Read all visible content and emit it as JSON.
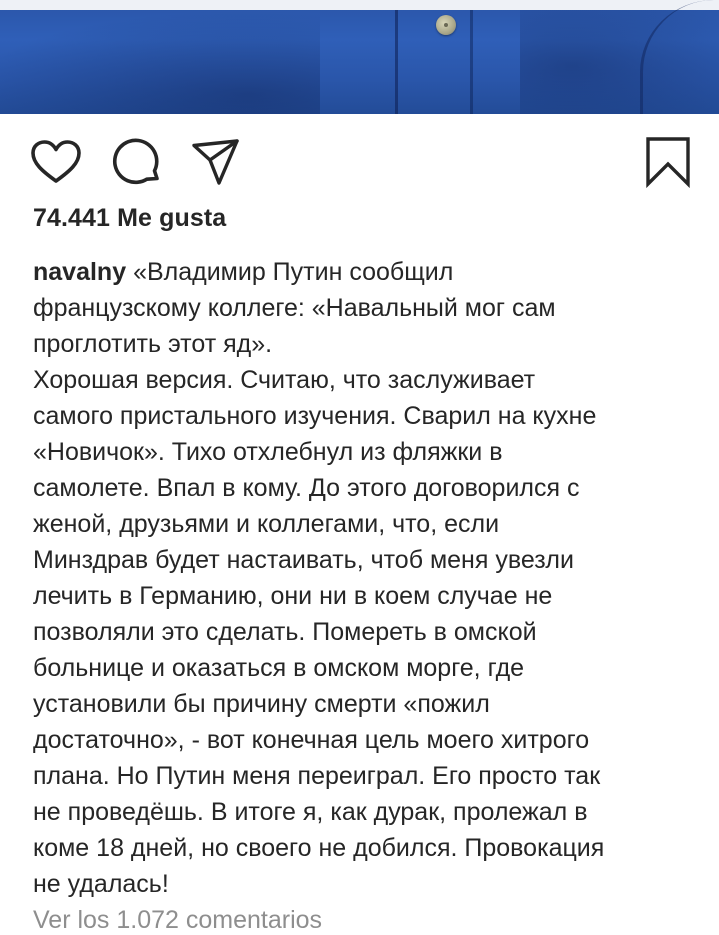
{
  "post": {
    "username": "navalny",
    "likes": "74.441 Me gusta",
    "caption_lines": [
      "«Владимир Путин сообщил",
      "французскому коллеге: «Навальный мог сам",
      "проглотить этот яд».",
      "Хорошая версия. Считаю, что заслуживает",
      "самого пристального изучения. Сварил на кухне",
      "«Новичок». Тихо отхлебнул из фляжки в",
      "самолете. Впал в кому. До этого договорился с",
      "женой, друзьями и коллегами, что, если",
      "Минздрав будет настаивать, чтоб меня увезли",
      "лечить в Германию, они ни в коем случае не",
      "позволяли это сделать. Помереть в омской",
      "больнице и оказаться в омском морге, где",
      "установили бы причину смерти «пожил",
      "достаточно», - вот конечная цель моего хитрого",
      "плана. Но Путин меня переиграл. Его просто так",
      "не проведёшь. В итоге я, как дурак, пролежал в",
      "коме 18 дней, но своего не добился. Провокация",
      "не удалась!"
    ],
    "view_comments": "Ver los 1.072 comentarios"
  },
  "actions": {
    "like_icon": "heart-icon",
    "comment_icon": "comment-bubble-icon",
    "share_icon": "paper-plane-icon",
    "save_icon": "bookmark-icon"
  },
  "colors": {
    "text": "#262626",
    "muted": "#8e8e8e",
    "shirt": "#2f5fb8"
  }
}
